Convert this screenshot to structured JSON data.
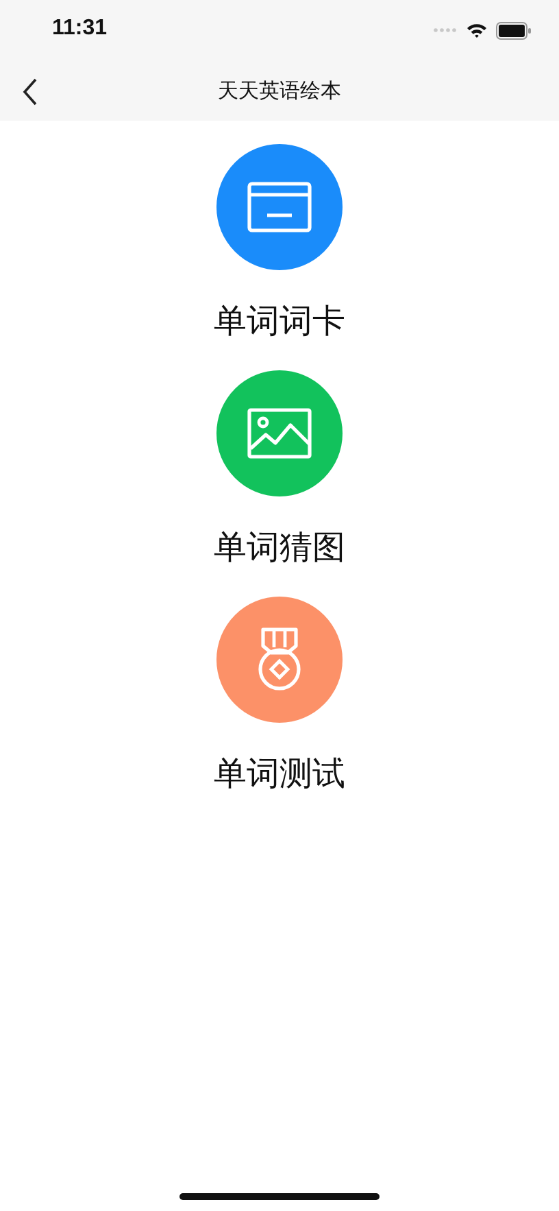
{
  "status_bar": {
    "time": "11:31"
  },
  "nav_bar": {
    "title": "天天英语绘本"
  },
  "menu": [
    {
      "kind": "card",
      "label": "单词词卡",
      "color": "#1a8cfa"
    },
    {
      "kind": "image",
      "label": "单词猜图",
      "color": "#12c25c"
    },
    {
      "kind": "medal",
      "label": "单词测试",
      "color": "#fc9168"
    }
  ]
}
